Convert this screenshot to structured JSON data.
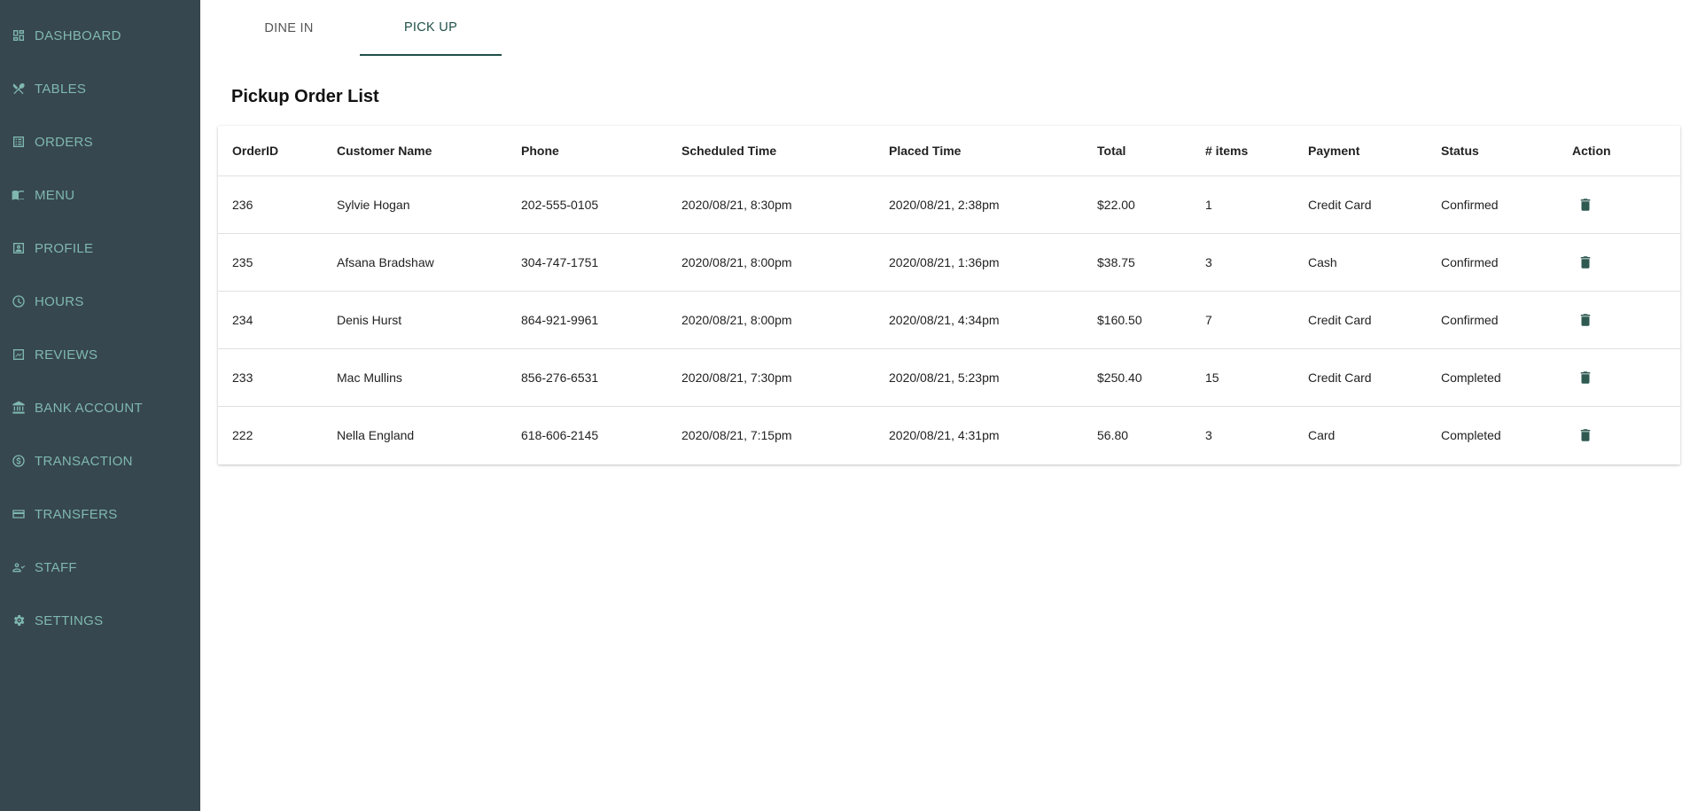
{
  "sidebar": {
    "items": [
      {
        "label": "DASHBOARD",
        "icon": "dashboard-icon"
      },
      {
        "label": "TABLES",
        "icon": "utensils-icon"
      },
      {
        "label": "ORDERS",
        "icon": "list-icon"
      },
      {
        "label": "MENU",
        "icon": "book-icon"
      },
      {
        "label": "PROFILE",
        "icon": "profile-icon"
      },
      {
        "label": "HOURS",
        "icon": "clock-icon"
      },
      {
        "label": "REVIEWS",
        "icon": "reviews-icon"
      },
      {
        "label": "BANK ACCOUNT",
        "icon": "bank-icon"
      },
      {
        "label": "TRANSACTION",
        "icon": "dollar-icon"
      },
      {
        "label": "TRANSFERS",
        "icon": "card-icon"
      },
      {
        "label": "STAFF",
        "icon": "staff-icon"
      },
      {
        "label": "SETTINGS",
        "icon": "gear-icon"
      }
    ]
  },
  "tabs": [
    {
      "label": "DINE IN",
      "active": false
    },
    {
      "label": "PICK UP",
      "active": true
    }
  ],
  "page_title": "Pickup Order List",
  "table": {
    "headers": [
      "OrderID",
      "Customer Name",
      "Phone",
      "Scheduled Time",
      "Placed Time",
      "Total",
      "# items",
      "Payment",
      "Status",
      "Action"
    ],
    "rows": [
      [
        "236",
        "Sylvie Hogan",
        "202-555-0105",
        "2020/08/21, 8:30pm",
        "2020/08/21, 2:38pm",
        "$22.00",
        "1",
        "Credit Card",
        "Confirmed"
      ],
      [
        "235",
        "Afsana Bradshaw",
        "304-747-1751",
        "2020/08/21, 8:00pm",
        "2020/08/21, 1:36pm",
        "$38.75",
        "3",
        "Cash",
        "Confirmed"
      ],
      [
        "234",
        "Denis Hurst",
        "864-921-9961",
        "2020/08/21, 8:00pm",
        "2020/08/21, 4:34pm",
        "$160.50",
        "7",
        "Credit Card",
        "Confirmed"
      ],
      [
        "233",
        "Mac Mullins",
        "856-276-6531",
        "2020/08/21, 7:30pm",
        "2020/08/21, 5:23pm",
        "$250.40",
        "15",
        "Credit Card",
        "Completed"
      ],
      [
        "222",
        "Nella England",
        "618-606-2145",
        "2020/08/21, 7:15pm",
        "2020/08/21, 4:31pm",
        "56.80",
        "3",
        "Card",
        "Completed"
      ]
    ]
  },
  "colors": {
    "sidebar_bg": "#37474f",
    "sidebar_text": "#7fb8b0",
    "accent": "#1f4f48"
  }
}
